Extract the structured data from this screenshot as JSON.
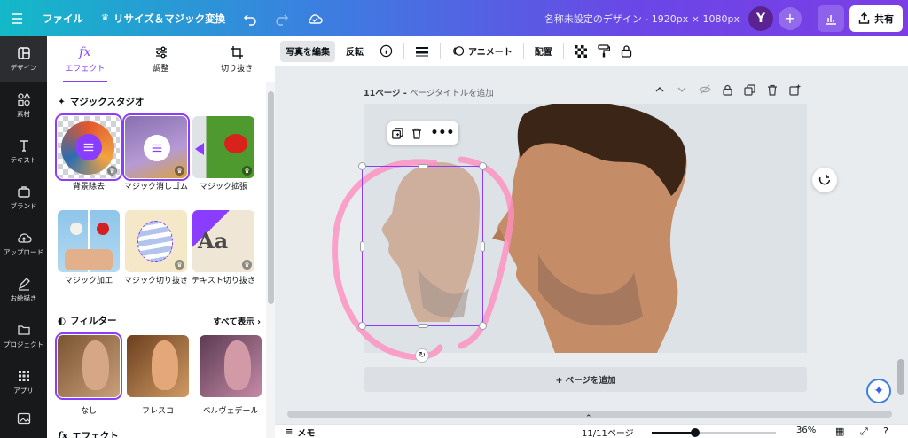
{
  "topbar": {
    "file": "ファイル",
    "resize": "リサイズ＆マジック変換",
    "title": "名称未設定のデザイン - 1920px × 1080px",
    "avatar": "Y",
    "share": "共有"
  },
  "rail": [
    {
      "name": "design",
      "label": "デザイン",
      "icon": "layout-icon"
    },
    {
      "name": "elements",
      "label": "素材",
      "icon": "shapes-icon"
    },
    {
      "name": "text",
      "label": "テキスト",
      "icon": "text-icon"
    },
    {
      "name": "brand",
      "label": "ブランド",
      "icon": "briefcase-icon"
    },
    {
      "name": "upload",
      "label": "アップロード",
      "icon": "cloud-upload-icon"
    },
    {
      "name": "draw",
      "label": "お絵描き",
      "icon": "pen-icon"
    },
    {
      "name": "projects",
      "label": "プロジェクト",
      "icon": "folder-icon"
    },
    {
      "name": "apps",
      "label": "アプリ",
      "icon": "grid-icon"
    }
  ],
  "panel": {
    "tabs": [
      {
        "label": "エフェクト",
        "icon": "fx"
      },
      {
        "label": "調整",
        "icon": "sliders-icon"
      },
      {
        "label": "切り抜き",
        "icon": "crop-icon"
      }
    ],
    "magic_studio": {
      "title": "マジックスタジオ",
      "items": [
        "背景除去",
        "マジック消しゴム",
        "マジック拡張",
        "マジック加工",
        "マジック切り抜き",
        "テキスト切り抜き"
      ]
    },
    "filters": {
      "title": "フィルター",
      "see_all": "すべて表示",
      "items": [
        "なし",
        "フレスコ",
        "ベルヴェデール"
      ]
    },
    "effects_title": "エフェクト"
  },
  "toolbar": {
    "edit_photo": "写真を編集",
    "flip": "反転",
    "animate": "アニメート",
    "position": "配置"
  },
  "canvas": {
    "page_label": "11ページ",
    "page_title_placeholder": "ページタイトルを追加",
    "add_page": "+ ページを追加"
  },
  "bottom": {
    "notes": "メモ",
    "page_count": "11/11ページ",
    "zoom": "36%",
    "zoom_fraction": 0.36
  },
  "colors": {
    "accent": "#8b3dff",
    "rail_bg": "#18191b",
    "sketch": "#ff8fbf"
  }
}
